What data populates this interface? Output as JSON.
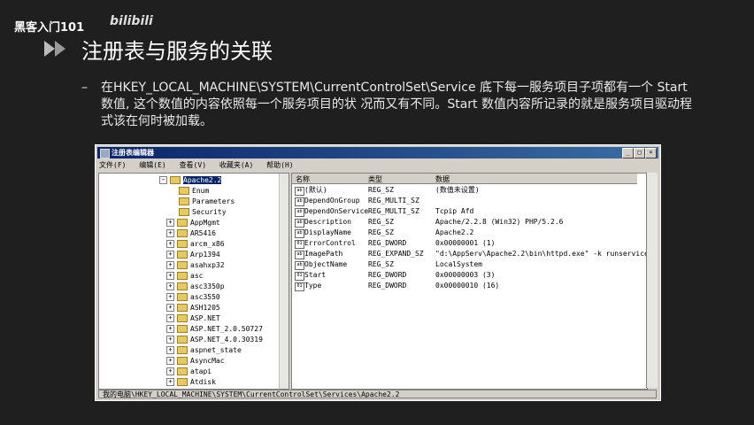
{
  "watermark": {
    "text1": "黑客入门101",
    "text2": "bilibili"
  },
  "slide": {
    "title": "注册表与服务的关联",
    "bullet_dash": "–",
    "bullet_text": "在HKEY_LOCAL_MACHINE\\SYSTEM\\CurrentControlSet\\Service 底下每一服务项目子项都有一个 Start 数值, 这个数值的内容依照每一个服务项目的状 况而又有不同。Start 数值内容所记录的就是服务项目驱动程式该在何时被加载。"
  },
  "window": {
    "title": "注册表编辑器",
    "min": "_",
    "max": "□",
    "close": "×",
    "menu": [
      "文件(F)",
      "编辑(E)",
      "查看(V)",
      "收藏夹(A)",
      "帮助(H)"
    ],
    "tree": [
      {
        "label": "Apache2.2",
        "selected": true
      },
      {
        "label": "Enum"
      },
      {
        "label": "Parameters"
      },
      {
        "label": "Security"
      },
      {
        "label": "AppMgmt"
      },
      {
        "label": "AR5416"
      },
      {
        "label": "arcm_x86"
      },
      {
        "label": "Arp1394"
      },
      {
        "label": "asahxp32"
      },
      {
        "label": "asc"
      },
      {
        "label": "asc3350p"
      },
      {
        "label": "asc3550"
      },
      {
        "label": "ASH1205"
      },
      {
        "label": "ASP.NET"
      },
      {
        "label": "ASP.NET_2.0.50727"
      },
      {
        "label": "ASP.NET_4.0.30319"
      },
      {
        "label": "aspnet_state"
      },
      {
        "label": "AsyncMac"
      },
      {
        "label": "atapi"
      },
      {
        "label": "Atdisk"
      }
    ],
    "columns": [
      "名称",
      "类型",
      "数据"
    ],
    "values": [
      {
        "name": "(默认)",
        "type": "REG_SZ",
        "data": "(数值未设置)"
      },
      {
        "name": "DependOnGroup",
        "type": "REG_MULTI_SZ",
        "data": ""
      },
      {
        "name": "DependOnService",
        "type": "REG_MULTI_SZ",
        "data": "Tcpip Afd"
      },
      {
        "name": "Description",
        "type": "REG_SZ",
        "data": "Apache/2.2.8 (Win32) PHP/5.2.6"
      },
      {
        "name": "DisplayName",
        "type": "REG_SZ",
        "data": "Apache2.2"
      },
      {
        "name": "ErrorControl",
        "type": "REG_DWORD",
        "data": "0x00000001 (1)"
      },
      {
        "name": "ImagePath",
        "type": "REG_EXPAND_SZ",
        "data": "\"d:\\AppServ\\Apache2.2\\bin\\httpd.exe\" -k runservice"
      },
      {
        "name": "ObjectName",
        "type": "REG_SZ",
        "data": "LocalSystem"
      },
      {
        "name": "Start",
        "type": "REG_DWORD",
        "data": "0x00000003 (3)"
      },
      {
        "name": "Type",
        "type": "REG_DWORD",
        "data": "0x00000010 (16)"
      }
    ],
    "status": "我的电脑\\HKEY_LOCAL_MACHINE\\SYSTEM\\CurrentControlSet\\Services\\Apache2.2"
  }
}
